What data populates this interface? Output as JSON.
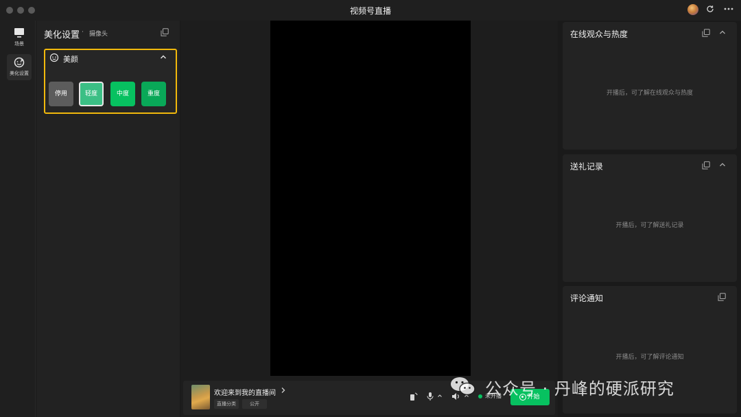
{
  "window": {
    "title": "视频号直播"
  },
  "rail": {
    "items": [
      {
        "label": "场景",
        "icon": "monitor-icon"
      },
      {
        "label": "美化设置",
        "icon": "beauty-face-icon"
      }
    ]
  },
  "panel": {
    "title": "美化设置",
    "separator": "·",
    "subtitle": "摄像头",
    "beauty": {
      "title": "美颜",
      "levels": [
        "停用",
        "轻度",
        "中度",
        "重度"
      ],
      "selected": "轻度"
    }
  },
  "stream": {
    "room_title": "欢迎来到我的直播间",
    "category_tag": "直播分类",
    "visibility_tag": "公开",
    "status": "未开播",
    "start_label": "开始"
  },
  "right_panels": [
    {
      "title": "在线观众与热度",
      "empty_text": "开播后，可了解在线观众与热度"
    },
    {
      "title": "送礼记录",
      "empty_text": "开播后，可了解送礼记录"
    },
    {
      "title": "评论通知",
      "empty_text": "开播后，可了解评论通知"
    }
  ],
  "watermark": {
    "text": "公众号 · 丹峰的硬派研究"
  },
  "colors": {
    "accent": "#07c160",
    "highlight_border": "#f2b90c",
    "background": "#1a1a1a"
  }
}
